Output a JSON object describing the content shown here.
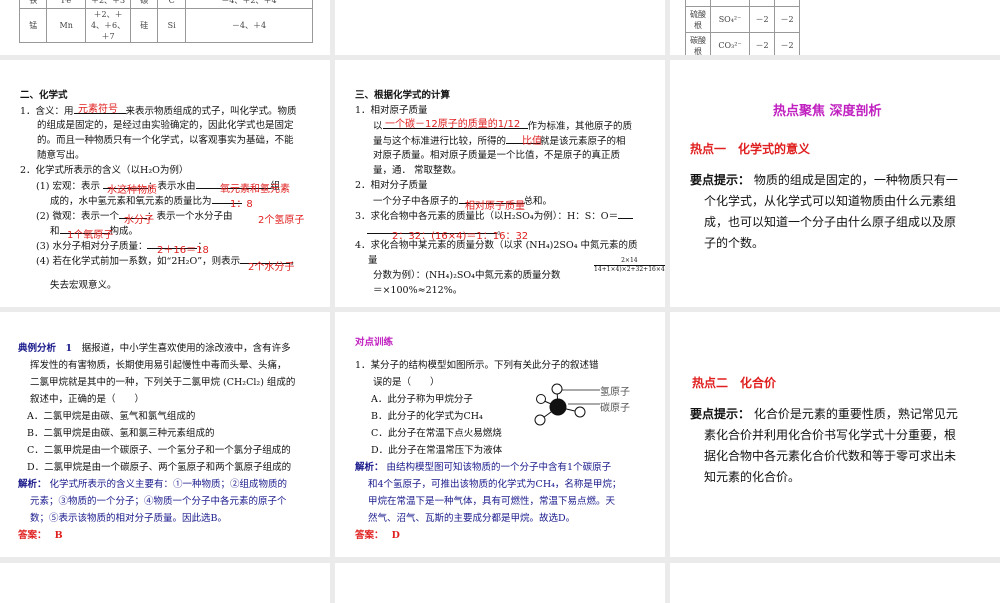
{
  "slide1": {
    "rows": [
      [
        "铁",
        "Fe",
        "＋2、＋3",
        "碳",
        "C",
        "－4、＋2、＋4"
      ],
      [
        "锰",
        "Mn",
        "＋2、＋4、＋6、＋7",
        "硅",
        "Si",
        "－4、＋4"
      ]
    ]
  },
  "slide3top": {
    "rows": [
      [
        "硫酸根",
        "SO₄²⁻",
        "－2",
        "－2"
      ],
      [
        "碳酸根",
        "CO₃²⁻",
        "－2",
        "－2"
      ]
    ]
  },
  "slide4": {
    "title": "二、化学式",
    "l1a": "1．含义：用",
    "l1b": "来表示物质组成的式子，叫化学式。物质",
    "l2": "的组成是固定的，是经过由实验确定的，因此化学式也是固定",
    "l3": "的。而且一种物质只有一个化学式，以客观事实为基础，不能",
    "l4": "随意写出。",
    "l5": "2．化学式所表示的含义（以H₂O为例）",
    "l6a": "(1) 宏观：表示",
    "l6b": "；表示水由",
    "l6c": "组",
    "l7": "成的，水中氢元素和氧元素的质量比为",
    "l8a": "(2) 微观：表示一个",
    "l8b": "；表示一个水分子由",
    "l9a": "和",
    "l9b": "构成。",
    "l10": "(3) 水分子相对分子质量：",
    "l11a": "(4) 若在化学式前加一系数，如“2H₂O”，则表示",
    "l12": "失去宏观意义。",
    "ans": [
      "元素符号",
      "水这种物质",
      "氧元素和氢元素",
      "1：8",
      "水分子",
      "2个氢原子",
      "1个氧原子",
      "2＋16＝18",
      "2个水分子"
    ]
  },
  "slide5": {
    "title": "三、根据化学式的计算",
    "l1": "1．相对原子质量",
    "l2a": "以",
    "l2b": "作为标准，其他原子的质",
    "l3a": "量与这个标准进行比较，所得的",
    "l3b": "就是该元素原子的相",
    "l4": "对原子质量。相对原子质量是一个比值，不是原子的真正质",
    "l5": "量，通． 常取整数。",
    "l6": "2．相对分子质量",
    "l7a": "一个分子中各原子的",
    "l7b": "总和。",
    "l8": "3．求化合物中各元素的质量比（以H₂SO₄为例）：H：S：O＝",
    "l9": "。",
    "l10": "4．求化合物中某元素的质量分数（以求 (NH₄)2SO₄ 中氮元素的质",
    "l11": "量",
    "l12": "分数为例）：(NH₄)₂SO₄中氮元素的质量分数",
    "frac_num": "2×14",
    "frac_den": "14+1×4)×2+32+16×4",
    "l13": "＝×100%≈212%。",
    "ans": [
      "一个碳－12原子的质量的1/12",
      "比值",
      "相对原子质量",
      "2：32：(16×4)＝1：16：32"
    ]
  },
  "slide6": {
    "title": "热点聚焦  深度剖析",
    "h1": "热点一　化学式的意义",
    "label": "要点提示：",
    "p": [
      "物质的组成是固定的，一种物质只有一",
      "个化学式，从化学式可以知道物质由什么元素组",
      "成，也可以知道一个分子由什么原子组成以及原",
      "子的个数。"
    ]
  },
  "slide7": {
    "head": "典例分析　1",
    "q": [
      "据报道，中小学生喜欢使用的涂改液中，含有许多",
      "挥发性的有害物质，长期使用易引起慢性中毒而头晕、头痛，",
      "二氯甲烷就是其中的一种，下列关于二氯甲烷 (CH₂Cl₂) 组成的",
      "叙述中，正确的是（　　）"
    ],
    "opts": [
      "A．二氯甲烷是由碳、氢气和氯气组成的",
      "B．二氯甲烷是由碳、氢和氯三种元素组成的",
      "C．二氯甲烷是由一个碳原子、一个氢分子和一个氯分子组成的",
      "D．二氯甲烷是由一个碳原子、两个氢原子和两个氯原子组成的"
    ],
    "jx": "解析：",
    "jxt": [
      "化学式所表示的含义主要有：①一种物质；②组成物质的",
      "元素；③物质的一个分子；④物质一个分子中各元素的原子个",
      "数；⑤表示该物质的相对分子质量。因此选B。"
    ],
    "da": "答案：",
    "dav": "B"
  },
  "slide8": {
    "head": "对点训练",
    "q": [
      "1．某分子的结构模型如图所示。下列有关此分子的叙述错",
      "误的是（　　）"
    ],
    "opts": [
      "A．此分子称为甲烷分子",
      "B．此分子的化学式为CH₄",
      "C．此分子在常温下点火易燃烧",
      "D．此分子在常温常压下为液体"
    ],
    "lblH": "氢原子",
    "lblC": "碳原子",
    "jx": "解析：",
    "jxt": [
      "由结构模型图可知该物质的一个分子中含有1个碳原子",
      "和4个氢原子，可推出该物质的化学式为CH₄，名称是甲烷；",
      "甲烷在常温下是一种气体，具有可燃性，常温下易点燃。天",
      "然气、沼气、瓦斯的主要成分都是甲烷。故选D。"
    ],
    "da": "答案：",
    "dav": "D"
  },
  "slide9": {
    "h2": "热点二　化合价",
    "label": "要点提示：",
    "p": [
      "化合价是元素的重要性质，熟记常见元",
      "素化合价并利用化合价书写化学式十分重要，根",
      "据化合物中各元素化合价代数和等于零可求出未",
      "知元素的化合价。"
    ]
  }
}
